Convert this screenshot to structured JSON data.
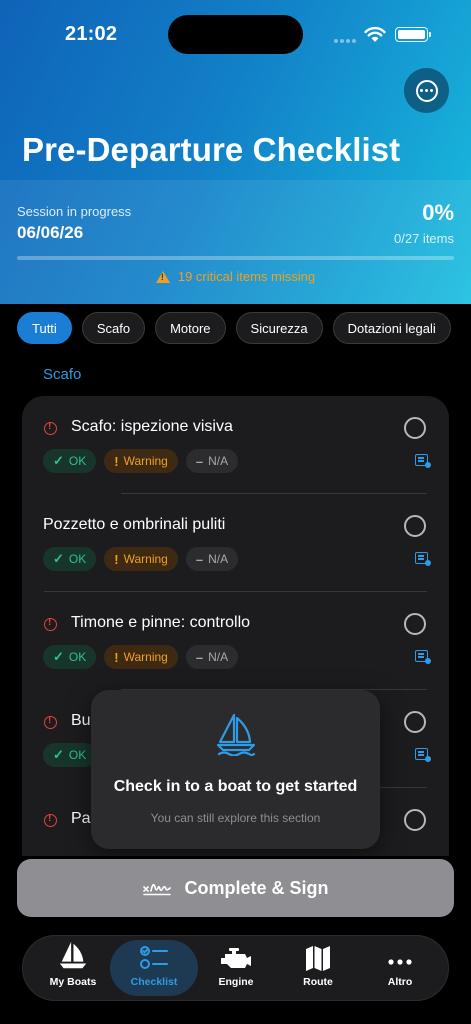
{
  "status_bar": {
    "time": "21:02"
  },
  "header": {
    "title": "Pre-Departure Checklist",
    "session_label": "Session in progress",
    "session_date": "06/06/26",
    "progress_percent": "0%",
    "progress_items": "0/27 items",
    "progress_fraction": 0,
    "critical_missing": "19 critical items missing"
  },
  "filters": [
    {
      "label": "Tutti",
      "active": true
    },
    {
      "label": "Scafo",
      "active": false
    },
    {
      "label": "Motore",
      "active": false
    },
    {
      "label": "Sicurezza",
      "active": false
    },
    {
      "label": "Dotazioni legali",
      "active": false
    }
  ],
  "section": {
    "title": "Scafo"
  },
  "status_labels": {
    "ok": "OK",
    "warning": "Warning",
    "na": "N/A"
  },
  "items": [
    {
      "title": "Scafo: ispezione visiva",
      "critical": true
    },
    {
      "title": "Pozzetto e ombrinali puliti",
      "critical": false
    },
    {
      "title": "Timone e pinne: controllo",
      "critical": true
    },
    {
      "title": "Bu",
      "critical": true
    },
    {
      "title": "Pas",
      "critical": true
    }
  ],
  "toast": {
    "title": "Check in to a boat to get started",
    "subtitle": "You can still explore this section",
    "icon": "sailboat-icon"
  },
  "complete_button": {
    "label": "Complete & Sign",
    "icon": "signature-icon"
  },
  "tabbar": [
    {
      "label": "My Boats",
      "icon": "sailboat-icon",
      "active": false
    },
    {
      "label": "Checklist",
      "icon": "checklist-icon",
      "active": true
    },
    {
      "label": "Engine",
      "icon": "engine-icon",
      "active": false
    },
    {
      "label": "Route",
      "icon": "map-icon",
      "active": false
    },
    {
      "label": "Altro",
      "icon": "ellipsis-icon",
      "active": false
    }
  ],
  "colors": {
    "accent": "#2e9be6",
    "ok": "#2fc28a",
    "warning": "#f0a020",
    "critical": "#e0443a"
  }
}
